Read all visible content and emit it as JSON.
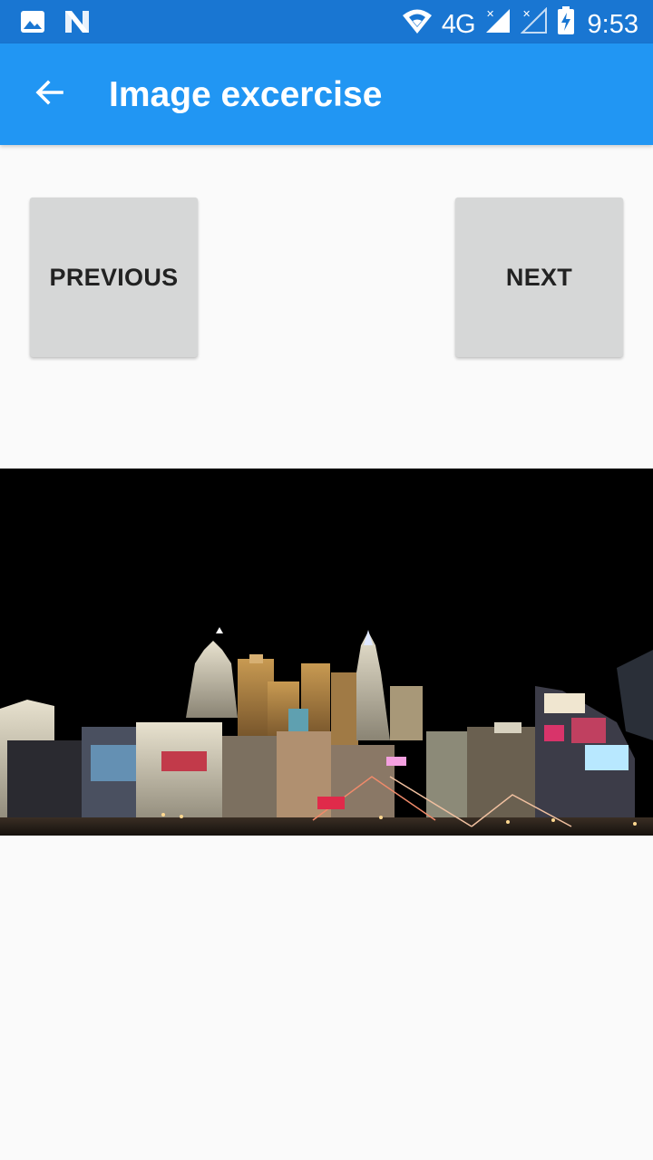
{
  "status_bar": {
    "left_icons": [
      "image-icon",
      "n-logo-icon"
    ],
    "network": "4G",
    "time": "9:53",
    "right_icons": [
      "wifi-icon",
      "signal-icon",
      "signal-empty-icon",
      "battery-charging-icon"
    ]
  },
  "app_bar": {
    "title": "Image excercise",
    "back_icon": "arrow-left-icon"
  },
  "buttons": {
    "previous_label": "PREVIOUS",
    "next_label": "NEXT"
  },
  "image": {
    "subject": "night city skyline"
  },
  "colors": {
    "status_bar": "#1976d2",
    "app_bar": "#2196f3",
    "button_bg": "#d6d7d7",
    "background": "#fafafa",
    "photo_bg": "#000000"
  }
}
